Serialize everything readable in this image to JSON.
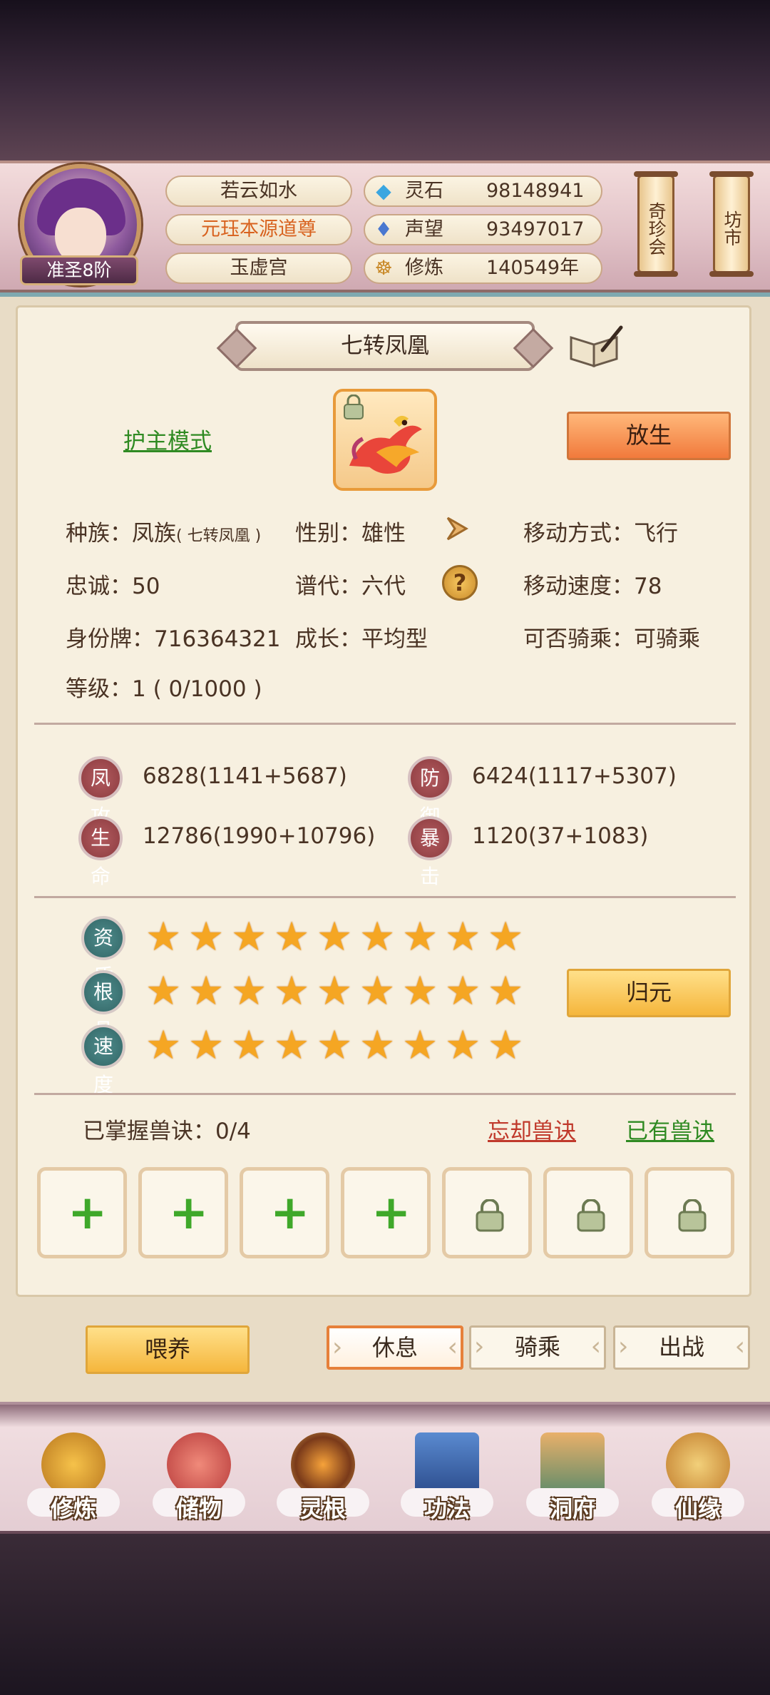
{
  "header": {
    "rank": "准圣8阶",
    "names": [
      "若云如水",
      "元珏本源道尊",
      "玉虚宫"
    ],
    "stats": [
      {
        "icon": "spirit-stone-icon",
        "name": "灵石",
        "value": "98148941"
      },
      {
        "icon": "reputation-icon",
        "name": "声望",
        "value": "93497017"
      },
      {
        "icon": "cultivation-icon",
        "name": "修炼",
        "value": "140549年"
      }
    ],
    "side_buttons": [
      "奇珍会",
      "坊市"
    ]
  },
  "pet": {
    "name": "七转凤凰",
    "guard_mode": "护主模式",
    "release_button": "放生",
    "info": {
      "race_label": "种族：凤族",
      "race_sub": "( 七转凤凰 )",
      "gender": "性别：雄性",
      "move_type": "移动方式：飞行",
      "loyalty": "忠诚：50",
      "generation": "谱代：六代",
      "move_speed": "移动速度：78",
      "id_tag": "身份牌：716364321",
      "growth": "成长：平均型",
      "rideable": "可否骑乘：可骑乘",
      "level": "等级：1 ( 0/1000 )"
    },
    "attributes": [
      {
        "label": "凤攻",
        "value": "6828(1141+5687)"
      },
      {
        "label": "防御",
        "value": "6424(1117+5307)"
      },
      {
        "label": "生命",
        "value": "12786(1990+10796)"
      },
      {
        "label": "暴击",
        "value": "1120(37+1083)"
      }
    ],
    "talents": [
      {
        "label": "资质",
        "stars": 9
      },
      {
        "label": "根骨",
        "stars": 9
      },
      {
        "label": "速度",
        "stars": 9
      }
    ],
    "reset_button": "归元",
    "skills_mastered": "已掌握兽诀：0/4",
    "forget_skill": "忘却兽诀",
    "owned_skills": "已有兽诀",
    "slots": [
      "add",
      "add",
      "add",
      "add",
      "locked",
      "locked",
      "locked"
    ]
  },
  "actions": {
    "feed": "喂养",
    "tabs": [
      "休息",
      "骑乘",
      "出战"
    ],
    "active_tab": "休息"
  },
  "nav": [
    "修炼",
    "储物",
    "灵根",
    "功法",
    "洞府",
    "仙缘"
  ],
  "colors": {
    "accent_orange": "#f17a3c",
    "accent_yellow": "#f5b63c",
    "link_green": "#2f8a22",
    "link_red": "#c0392b",
    "star": "#f5a623"
  }
}
